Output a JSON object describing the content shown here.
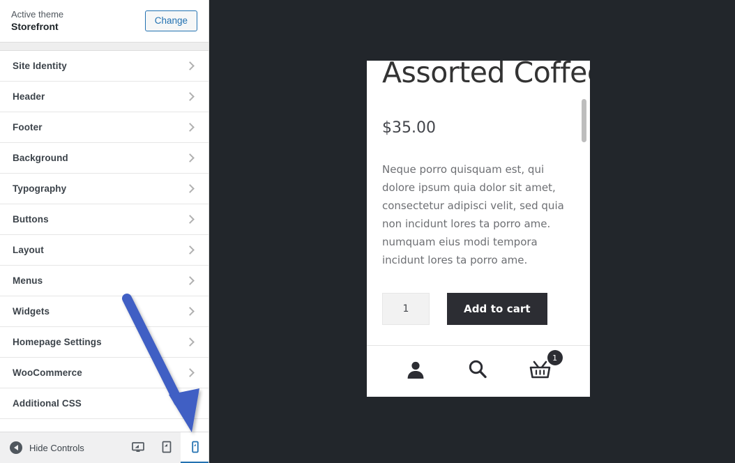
{
  "sidebar": {
    "theme": {
      "active_label": "Active theme",
      "name": "Storefront",
      "change_button": "Change"
    },
    "panels": [
      {
        "label": "Site Identity",
        "icon": "chevron-right-icon"
      },
      {
        "label": "Header",
        "icon": "chevron-right-icon"
      },
      {
        "label": "Footer",
        "icon": "chevron-right-icon"
      },
      {
        "label": "Background",
        "icon": "chevron-right-icon"
      },
      {
        "label": "Typography",
        "icon": "chevron-right-icon"
      },
      {
        "label": "Buttons",
        "icon": "chevron-right-icon"
      },
      {
        "label": "Layout",
        "icon": "chevron-right-icon"
      },
      {
        "label": "Menus",
        "icon": "chevron-right-icon"
      },
      {
        "label": "Widgets",
        "icon": "chevron-right-icon"
      },
      {
        "label": "Homepage Settings",
        "icon": "chevron-right-icon"
      },
      {
        "label": "WooCommerce",
        "icon": "chevron-right-icon"
      },
      {
        "label": "Additional CSS",
        "icon": "chevron-right-icon"
      }
    ]
  },
  "footer": {
    "hide_controls_label": "Hide Controls",
    "collapse_icon": "collapse-left-icon",
    "devices": [
      {
        "name": "desktop",
        "icon": "desktop-icon",
        "active": false
      },
      {
        "name": "tablet",
        "icon": "tablet-icon",
        "active": false
      },
      {
        "name": "mobile",
        "icon": "mobile-icon",
        "active": true
      }
    ],
    "active_device": "mobile"
  },
  "preview": {
    "product": {
      "title": "Assorted Coffee",
      "price": "$35.00",
      "description": "Neque porro quisquam est, qui dolore ipsum quia dolor sit amet, consectetur adipisci velit, sed quia non incidunt lores ta porro ame. numquam eius modi tempora incidunt lores ta porro ame.",
      "quantity": "1",
      "add_to_cart_label": "Add to cart"
    },
    "mobile_nav": [
      {
        "name": "account",
        "icon": "user-icon"
      },
      {
        "name": "search",
        "icon": "search-icon"
      },
      {
        "name": "cart",
        "icon": "basket-icon",
        "badge": "1"
      }
    ]
  },
  "annotation": {
    "arrow_color": "#3f5fc4",
    "points_to": "mobile"
  },
  "colors": {
    "accent": "#2271b1",
    "sidebar_bg": "#ffffff",
    "preview_bg": "#22262b",
    "button_dark": "#2c2d33",
    "arrow": "#3f5fc4"
  }
}
